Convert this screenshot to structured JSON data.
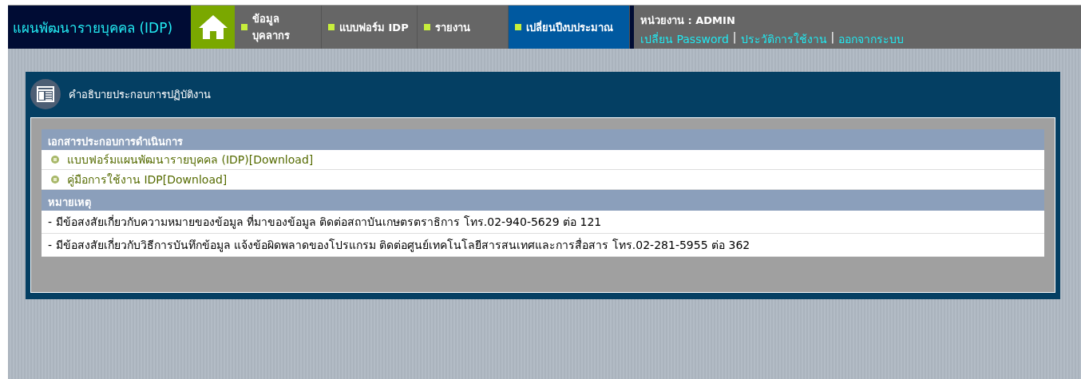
{
  "header": {
    "title": "แผนพัฒนารายบุคคล (IDP)",
    "menu": [
      {
        "label": "ข้อมูลบุคลากร",
        "selected": false
      },
      {
        "label": "แบบฟอร์ม IDP",
        "selected": false
      },
      {
        "label": "รายงาน",
        "selected": false
      },
      {
        "label": "เปลี่ยนปีงบประมาณ",
        "selected": true
      }
    ],
    "unit": "หน่วยงาน : ADMIN",
    "links": [
      "เปลี่ยน Password",
      "ประวัติการใช้งาน",
      "ออกจากระบบ"
    ],
    "separator": "|"
  },
  "panel": {
    "title": "คำอธิบายประกอบการปฏิบัติงาน",
    "sections": [
      {
        "heading": "เอกสารประกอบการดำเนินการ",
        "kind": "links",
        "items": [
          "แบบฟอร์มแผนพัฒนารายบุคคล (IDP)[Download]",
          "คู่มือการใช้งาน IDP[Download]"
        ]
      },
      {
        "heading": "หมายเหตุ",
        "kind": "notes",
        "items": [
          "- มีข้อสงสัยเกี่ยวกับความหมายของข้อมูล ที่มาของข้อมูล ติดต่อสถาบันเกษตรตราธิการ โทร.02-940-5629 ต่อ 121",
          "- มีข้อสงสัยเกี่ยวกับวิธีการบันทึกข้อมูล แจ้งข้อผิดพลาดของโปรแกรม ติดต่อศูนย์เทคโนโลยีสารสนเทศและการสื่อสาร โทร.02-281-5955 ต่อ 362"
        ]
      }
    ]
  }
}
